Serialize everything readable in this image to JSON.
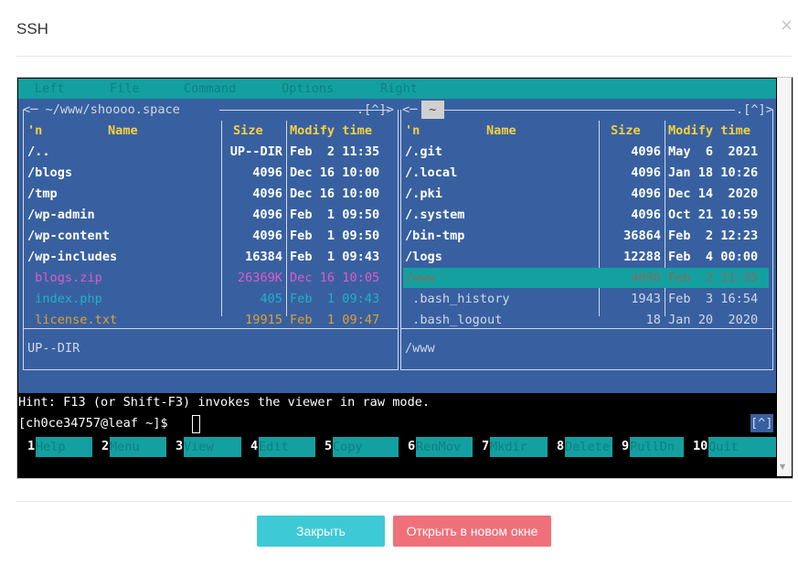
{
  "modal": {
    "title": "SSH",
    "close_symbol": "×",
    "buttons": {
      "close": "Закрыть",
      "open_new": "Открыть в новом окне"
    }
  },
  "mc": {
    "menu": [
      "Left",
      "File",
      "Command",
      "Options",
      "Right"
    ],
    "left_panel": {
      "path": "<─ ~/www/shoooo.space",
      "corner": ".[^]>",
      "headers": {
        "sort": "'n",
        "name": "Name",
        "size": "Size",
        "time": "Modify time"
      },
      "rows": [
        {
          "name": "/..",
          "size": "UP--DIR",
          "time": "Feb  2 11:35",
          "style": "dir"
        },
        {
          "name": "/blogs",
          "size": "4096",
          "time": "Dec 16 10:00",
          "style": "dir"
        },
        {
          "name": "/tmp",
          "size": "4096",
          "time": "Dec 16 10:00",
          "style": "dir"
        },
        {
          "name": "/wp-admin",
          "size": "4096",
          "time": "Feb  1 09:50",
          "style": "dir"
        },
        {
          "name": "/wp-content",
          "size": "4096",
          "time": "Feb  1 09:50",
          "style": "dir"
        },
        {
          "name": "/wp-includes",
          "size": "16384",
          "time": "Feb  1 09:43",
          "style": "dir"
        },
        {
          "name": " blogs.zip",
          "size": "26369K",
          "time": "Dec 16 10:05",
          "style": "archive"
        },
        {
          "name": " index.php",
          "size": "405",
          "time": "Feb  1 09:43",
          "style": "php"
        },
        {
          "name": " license.txt",
          "size": "19915",
          "time": "Feb  1 09:47",
          "style": "txt"
        }
      ],
      "status": "UP--DIR"
    },
    "right_panel": {
      "tab_left": "<─",
      "tab": " ~ ",
      "corner": ".[^]>",
      "headers": {
        "sort": "'n",
        "name": "Name",
        "size": "Size",
        "time": "Modify time"
      },
      "rows": [
        {
          "name": "/.git",
          "size": "4096",
          "time": "May  6  2021",
          "style": "dir"
        },
        {
          "name": "/.local",
          "size": "4096",
          "time": "Jan 18 10:26",
          "style": "dir"
        },
        {
          "name": "/.pki",
          "size": "4096",
          "time": "Dec 14  2020",
          "style": "dir"
        },
        {
          "name": "/.system",
          "size": "4096",
          "time": "Oct 21 10:59",
          "style": "dir"
        },
        {
          "name": "/bin-tmp",
          "size": "36864",
          "time": "Feb  2 12:23",
          "style": "dir"
        },
        {
          "name": "/logs",
          "size": "12288",
          "time": "Feb  4 00:00",
          "style": "dir"
        },
        {
          "name": "/www",
          "size": "4096",
          "time": "Feb  2 11:35",
          "style": "selected"
        },
        {
          "name": " .bash_history",
          "size": "1943",
          "time": "Feb  3 16:54",
          "style": "file"
        },
        {
          "name": " .bash_logout",
          "size": "18",
          "time": "Jan 20  2020",
          "style": "file"
        }
      ],
      "status": "/www"
    },
    "hint": "Hint: F13 (or Shift-F3) invokes the viewer in raw mode.",
    "prompt": "[ch0ce34757@leaf ~]$ ",
    "prompt_corner": "[^]",
    "fkeys": [
      {
        "num": "1",
        "label": "Help"
      },
      {
        "num": "2",
        "label": "Menu"
      },
      {
        "num": "3",
        "label": "View"
      },
      {
        "num": "4",
        "label": "Edit"
      },
      {
        "num": "5",
        "label": "Copy"
      },
      {
        "num": "6",
        "label": "RenMov"
      },
      {
        "num": "7",
        "label": "Mkdir"
      },
      {
        "num": "8",
        "label": "Delete"
      },
      {
        "num": "9",
        "label": "PullDn"
      },
      {
        "num": "10",
        "label": "Quit"
      }
    ],
    "colors": {
      "panel_bg": "#3860a0",
      "teal": "#14a0a0",
      "header_yellow": "#f5d040",
      "archive": "#e05ac8",
      "php": "#20b0c8",
      "txt": "#e0a030"
    }
  }
}
